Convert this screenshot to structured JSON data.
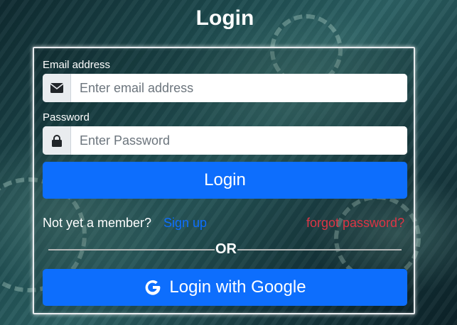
{
  "page": {
    "title": "Login"
  },
  "form": {
    "email": {
      "label": "Email address",
      "placeholder": "Enter email address",
      "icon": "envelope-icon"
    },
    "password": {
      "label": "Password",
      "placeholder": "Enter Password",
      "icon": "lock-icon"
    },
    "login_button": "Login"
  },
  "links": {
    "not_member_text": "Not yet a member?",
    "signup_label": "Sign up",
    "forgot_label": "forgot password?"
  },
  "divider": {
    "text": "OR"
  },
  "google": {
    "label": "Login with Google",
    "icon": "google-icon"
  },
  "colors": {
    "primary": "#0d6efd",
    "danger": "#dc3545",
    "addon_bg": "#e9ecef"
  }
}
